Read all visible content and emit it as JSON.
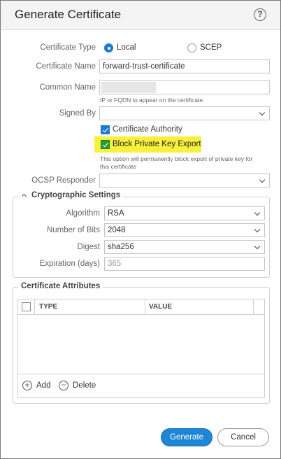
{
  "dialog": {
    "title": "Generate Certificate",
    "help_icon": "?"
  },
  "form": {
    "certificate_type": {
      "label": "Certificate Type",
      "options": [
        "Local",
        "SCEP"
      ],
      "selected": "Local"
    },
    "certificate_name": {
      "label": "Certificate Name",
      "value": "forward-trust-certificate"
    },
    "common_name": {
      "label": "Common Name",
      "value": "",
      "hint": "IP or FQDN to appear on the certificate"
    },
    "signed_by": {
      "label": "Signed By",
      "value": ""
    },
    "certificate_authority": {
      "label": "Certificate Authority",
      "checked": true
    },
    "block_private_key_export": {
      "label": "Block Private Key Export",
      "checked": true,
      "hint_line1": "This option will permanently block export of private key for",
      "hint_line2": "this certificate"
    },
    "ocsp_responder": {
      "label": "OCSP Responder",
      "value": ""
    }
  },
  "crypto": {
    "title": "Cryptographic Settings",
    "algorithm": {
      "label": "Algorithm",
      "value": "RSA"
    },
    "bits": {
      "label": "Number of Bits",
      "value": "2048"
    },
    "digest": {
      "label": "Digest",
      "value": "sha256"
    },
    "expiration": {
      "label": "Expiration (days)",
      "placeholder": "365"
    }
  },
  "attributes": {
    "title": "Certificate Attributes",
    "columns": [
      "TYPE",
      "VALUE"
    ],
    "rows": [],
    "add_label": "Add",
    "delete_label": "Delete"
  },
  "footer": {
    "generate_label": "Generate",
    "cancel_label": "Cancel"
  },
  "colors": {
    "accent": "#1f86d6",
    "highlight": "#f7f03c",
    "checked_green": "#2a9a3a"
  }
}
